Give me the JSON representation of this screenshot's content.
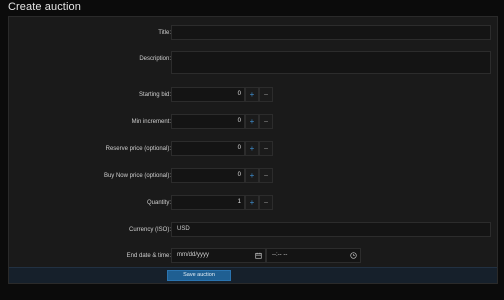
{
  "page": {
    "title": "Create auction"
  },
  "form": {
    "title_label": "Title:",
    "title_value": "",
    "description_label": "Description:",
    "description_value": "",
    "starting_bid": {
      "label": "Starting bid:",
      "value": "0",
      "plus": "+",
      "minus": "−"
    },
    "min_increment": {
      "label": "Min increment:",
      "value": "0",
      "plus": "+",
      "minus": "−"
    },
    "reserve_price": {
      "label": "Reserve price (optional):",
      "value": "0",
      "plus": "+",
      "minus": "−"
    },
    "buy_now_price": {
      "label": "Buy Now price (optional):",
      "value": "0",
      "plus": "+",
      "minus": "−"
    },
    "quantity": {
      "label": "Quantity:",
      "value": "1",
      "plus": "+",
      "minus": "−"
    },
    "currency": {
      "label": "Currency (ISO):",
      "value": "USD"
    },
    "end_datetime": {
      "label": "End date & time:",
      "date_placeholder": "mm/dd/yyyy",
      "time_placeholder": "--:-- --"
    },
    "save_label": "Save auction"
  }
}
